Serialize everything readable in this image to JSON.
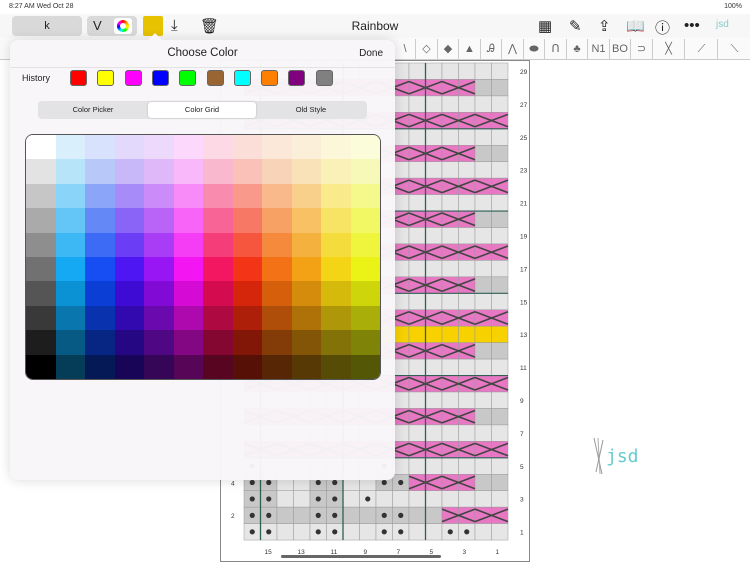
{
  "status": {
    "time": "8:27 AM  Wed Oct 28",
    "battery": "100%"
  },
  "toolbar": {
    "k_label": "k",
    "v_label": "V",
    "title": "Rainbow",
    "current_color": "#e6c200",
    "logo_text": "jsd"
  },
  "tools": [
    "\\",
    "◇",
    "◆",
    "▲",
    "Ꭿ",
    "⋀",
    "⬬",
    "ᑎ",
    "♣",
    "N1",
    "BO",
    "⊃",
    "╳",
    "⟋",
    "⟍"
  ],
  "popup": {
    "title": "Choose Color",
    "done": "Done",
    "history_label": "History",
    "history": [
      "#ff0000",
      "#ffff00",
      "#ff00ff",
      "#0000ff",
      "#00ff00",
      "#996633",
      "#00ffff",
      "#ff8000",
      "#800080",
      "#808080"
    ],
    "tabs": [
      "Color Picker",
      "Color Grid",
      "Old Style"
    ],
    "selected_tab": 1,
    "grid_hues": [
      200,
      225,
      255,
      275,
      300,
      340,
      8,
      25,
      38,
      52,
      62,
      85
    ]
  },
  "chart": {
    "row_numbers_right": [
      "29",
      "27",
      "25",
      "23",
      "21",
      "19",
      "17",
      "15",
      "13",
      "11",
      "9",
      "7",
      "5",
      "3",
      "1"
    ],
    "row_numbers_left": [
      "4",
      "2"
    ],
    "col_numbers": [
      "15",
      "13",
      "11",
      "9",
      "7",
      "5",
      "3",
      "1"
    ],
    "rows": [
      "................",
      "ppppppppppppppgg",
      "................",
      "pppppppppppppppp",
      "................",
      "ppppppppppppppgg",
      "................",
      "pppppppppppppppp",
      "................",
      "ppppppppppppppgg",
      "................",
      "pppppppppppppppp",
      "................",
      "ppppppppppppppgg",
      "................",
      "pppppppppppppppp",
      "yyyyyyyyyyyyyyyy",
      "ppppppppppppppgg",
      "................",
      "pppppppppppppppp",
      "................",
      "ppppppppppppppgg",
      "................",
      "pppppppppppppppp",
      "o.......o.......",
      "OO..OO..OOppppgg",
      "OO..OO.o........",
      "OOggOOggOOggpppp",
      "oo..oo..oo..oo.."
    ],
    "colors": {
      "pink": "#e878c4",
      "yellow": "#f7d200",
      "grey": "#c8c8c8",
      "light": "#e6e6e6",
      "line": "#2f5f55"
    }
  }
}
